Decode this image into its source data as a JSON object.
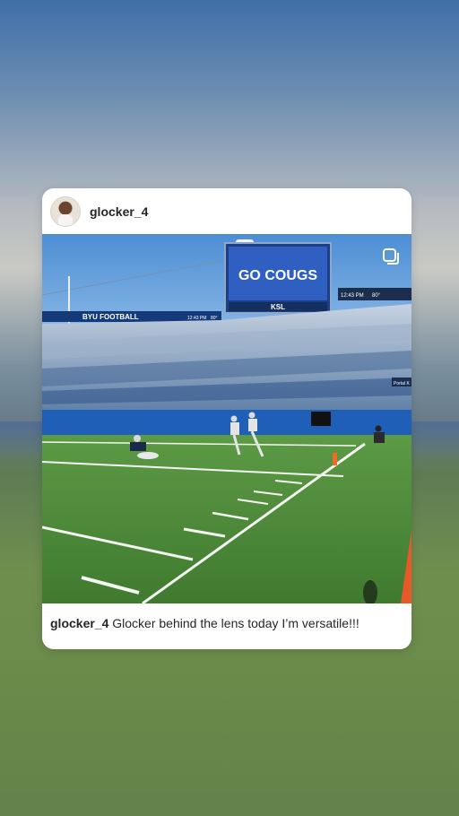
{
  "post": {
    "username": "glocker_4",
    "caption_username": "glocker_4",
    "caption_text": "Glocker behind the lens today I’m versatile!!!"
  },
  "photo": {
    "scoreboard_text": "GO COUGS",
    "ribbon_text": "BYU FOOTBALL",
    "clock_left": "12:43 PM",
    "temp_left": "80°",
    "clock_right": "12:43 PM",
    "temp_right": "80°",
    "sponsor_text": "KSL",
    "side_label": "Portal K"
  },
  "icons": {
    "avatar": "profile-avatar",
    "multi": "multiple-photos-icon"
  },
  "colors": {
    "card_bg": "#ffffff",
    "text": "#262626",
    "turf": "#4f8a3a",
    "wall_blue": "#1f5fb8",
    "sky": "#6ea6df"
  }
}
